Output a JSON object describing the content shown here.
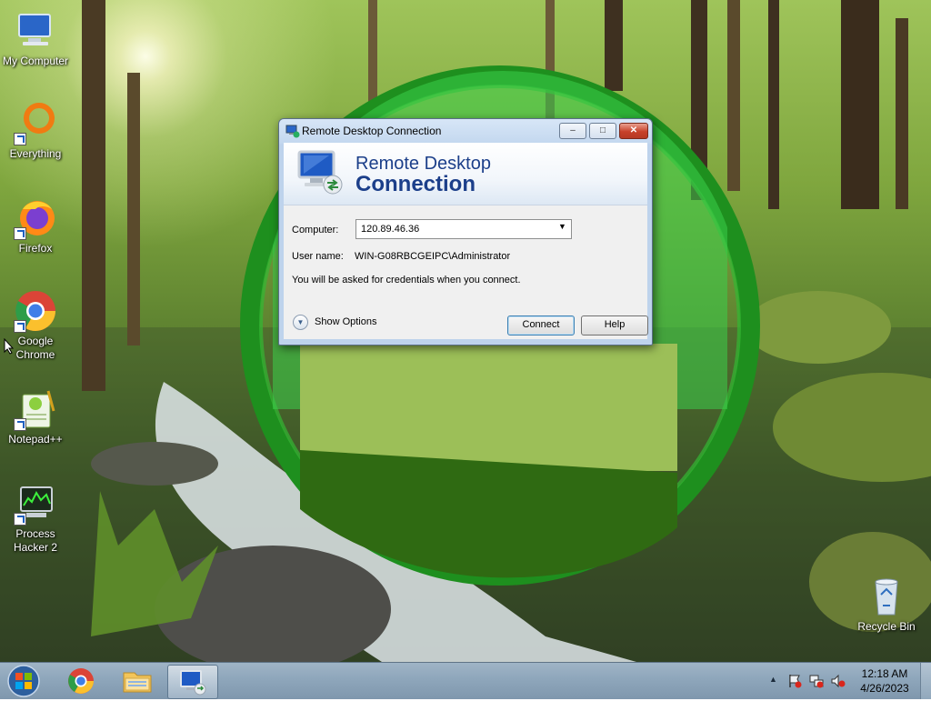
{
  "desktop": {
    "icons": [
      {
        "label": "My Computer",
        "icon": "computer-icon"
      },
      {
        "label": "Everything",
        "icon": "everything-search-icon"
      },
      {
        "label": "Firefox",
        "icon": "firefox-icon"
      },
      {
        "label": "Google Chrome",
        "icon": "chrome-icon"
      },
      {
        "label": "Notepad++",
        "icon": "notepadpp-icon"
      },
      {
        "label": "Process Hacker 2",
        "icon": "process-hacker-icon"
      }
    ],
    "recycle_bin": {
      "label": "Recycle Bin",
      "icon": "recycle-bin-icon"
    }
  },
  "rdc": {
    "title": "Remote Desktop Connection",
    "banner_line1": "Remote Desktop",
    "banner_line2": "Connection",
    "computer_label": "Computer:",
    "computer_value": "120.89.46.36",
    "username_label": "User name:",
    "username_value": "WIN-G08RBCGEIPC\\Administrator",
    "credentials_note": "You will be asked for credentials when you connect.",
    "show_options": "Show Options",
    "connect": "Connect",
    "help": "Help"
  },
  "taskbar": {
    "pinned": [
      "start-orb",
      "chrome",
      "file-explorer",
      "remote-desktop"
    ],
    "clock_time": "12:18 AM",
    "clock_date": "4/26/2023"
  },
  "colors": {
    "taskbar": "#8ea6bb",
    "dialog_frame": "#c4d8ef",
    "banner_text": "#1c3f8a",
    "close_red": "#c7412a"
  }
}
